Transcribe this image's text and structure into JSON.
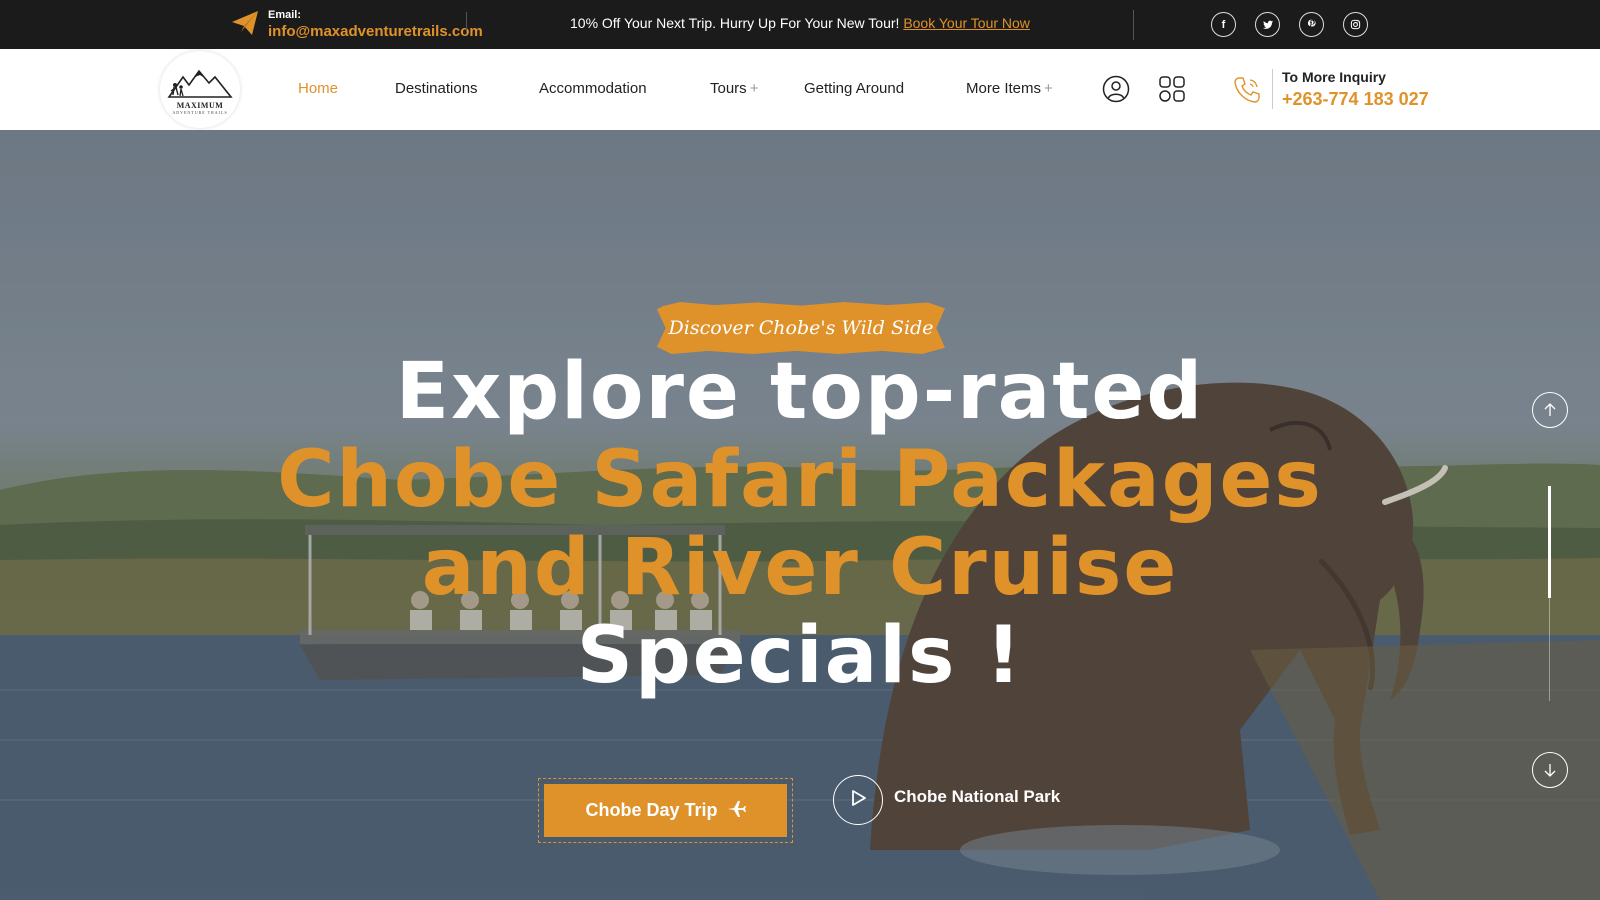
{
  "topbar": {
    "email_label": "Email:",
    "email_value": "info@maxadventuretrails.com",
    "promo_text": "10% Off Your Next Trip. Hurry Up For Your New Tour!",
    "promo_link": "Book Your Tour Now",
    "socials": [
      {
        "icon": "facebook-icon",
        "glyph": "f"
      },
      {
        "icon": "twitter-icon",
        "glyph": "t"
      },
      {
        "icon": "pinterest-icon",
        "glyph": "p"
      },
      {
        "icon": "instagram-icon",
        "glyph": "◎"
      }
    ]
  },
  "header": {
    "logo": {
      "text": "MAXIMUM",
      "sub": "ADVENTURE TRAILS"
    },
    "nav": [
      {
        "label": "Home",
        "active": true,
        "has_submenu": false
      },
      {
        "label": "Destinations",
        "active": false,
        "has_submenu": false
      },
      {
        "label": "Accommodation",
        "active": false,
        "has_submenu": false
      },
      {
        "label": "Tours",
        "active": false,
        "has_submenu": true
      },
      {
        "label": "Getting Around",
        "active": false,
        "has_submenu": false
      },
      {
        "label": "More Items",
        "active": false,
        "has_submenu": true
      }
    ],
    "submenu_marker": "+",
    "icons": [
      "user-icon",
      "grid-menu-icon",
      "phone-icon"
    ],
    "inquiry_label": "To More Inquiry",
    "inquiry_phone": "+263-774 183 027"
  },
  "hero": {
    "tag": "Discover Chobe's Wild Side",
    "headline": [
      {
        "text": "Explore top-rated",
        "color": "white"
      },
      {
        "text": "Chobe Safari Packages",
        "color": "orange"
      },
      {
        "text": "and River Cruise",
        "color": "orange"
      },
      {
        "text": "Specials !",
        "color": "white"
      }
    ],
    "button_label": "Chobe Day Trip",
    "button_icon": "plane-icon",
    "video_label": "Chobe National Park",
    "scroll_up_icon": "arrow-up-icon",
    "scroll_down_icon": "arrow-down-icon"
  },
  "colors": {
    "accent": "#e0922a",
    "topbar_bg": "#1b1b1b",
    "header_bg": "#ffffff"
  }
}
